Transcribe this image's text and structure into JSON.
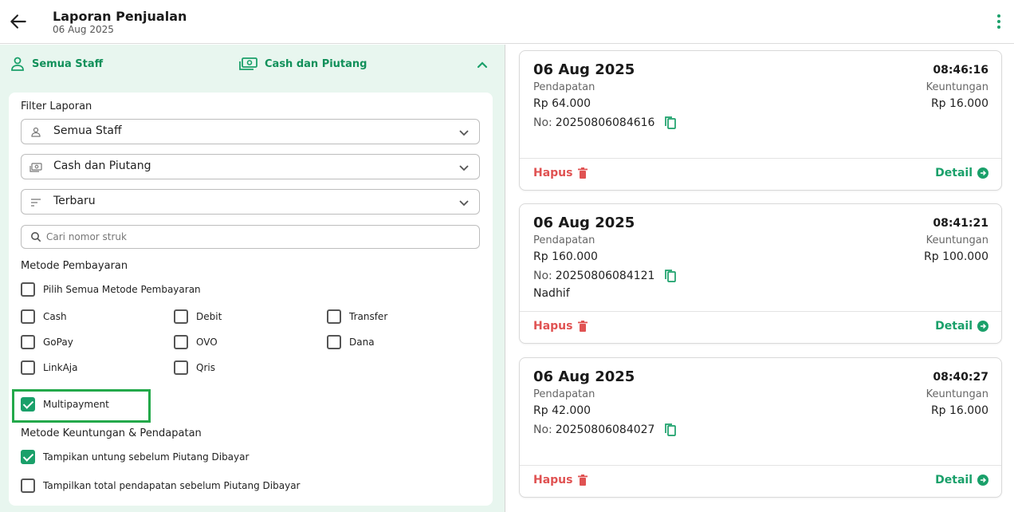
{
  "header": {
    "title": "Laporan Penjualan",
    "date": "06 Aug 2025"
  },
  "summary": {
    "staff": "Semua Staff",
    "payment": "Cash dan Piutang"
  },
  "filter": {
    "heading": "Filter Laporan",
    "staff_select": "Semua Staff",
    "payment_select": "Cash dan Piutang",
    "sort_select": "Terbaru",
    "search_placeholder": "Cari nomor struk",
    "payment_method_heading": "Metode Pembayaran",
    "select_all_label": "Pilih Semua Metode Pembayaran",
    "methods": {
      "cash": "Cash",
      "debit": "Debit",
      "transfer": "Transfer",
      "gopay": "GoPay",
      "ovo": "OVO",
      "dana": "Dana",
      "linkaja": "LinkAja",
      "qris": "Qris",
      "multipayment": "Multipayment"
    },
    "profit_heading": "Metode Keuntungan & Pendapatan",
    "profit_option_1": "Tampikan untung sebelum Piutang Dibayar",
    "profit_option_2": "Tampilkan total pendapatan sebelum Piutang Dibayar"
  },
  "labels": {
    "income": "Pendapatan",
    "profit": "Keuntungan",
    "no": "No:",
    "delete": "Hapus",
    "detail": "Detail"
  },
  "transactions": [
    {
      "date": "06 Aug 2025",
      "time": "08:46:16",
      "income": "Rp 64.000",
      "profit": "Rp 16.000",
      "number": "20250806084616",
      "customer": ""
    },
    {
      "date": "06 Aug 2025",
      "time": "08:41:21",
      "income": "Rp 160.000",
      "profit": "Rp 100.000",
      "number": "20250806084121",
      "customer": "Nadhif"
    },
    {
      "date": "06 Aug 2025",
      "time": "08:40:27",
      "income": "Rp 42.000",
      "profit": "Rp 16.000",
      "number": "20250806084027",
      "customer": ""
    }
  ],
  "colors": {
    "accent": "#1aa06a",
    "danger": "#e05252",
    "panel_bg": "#e8f6ef",
    "highlight": "#23a94a"
  }
}
